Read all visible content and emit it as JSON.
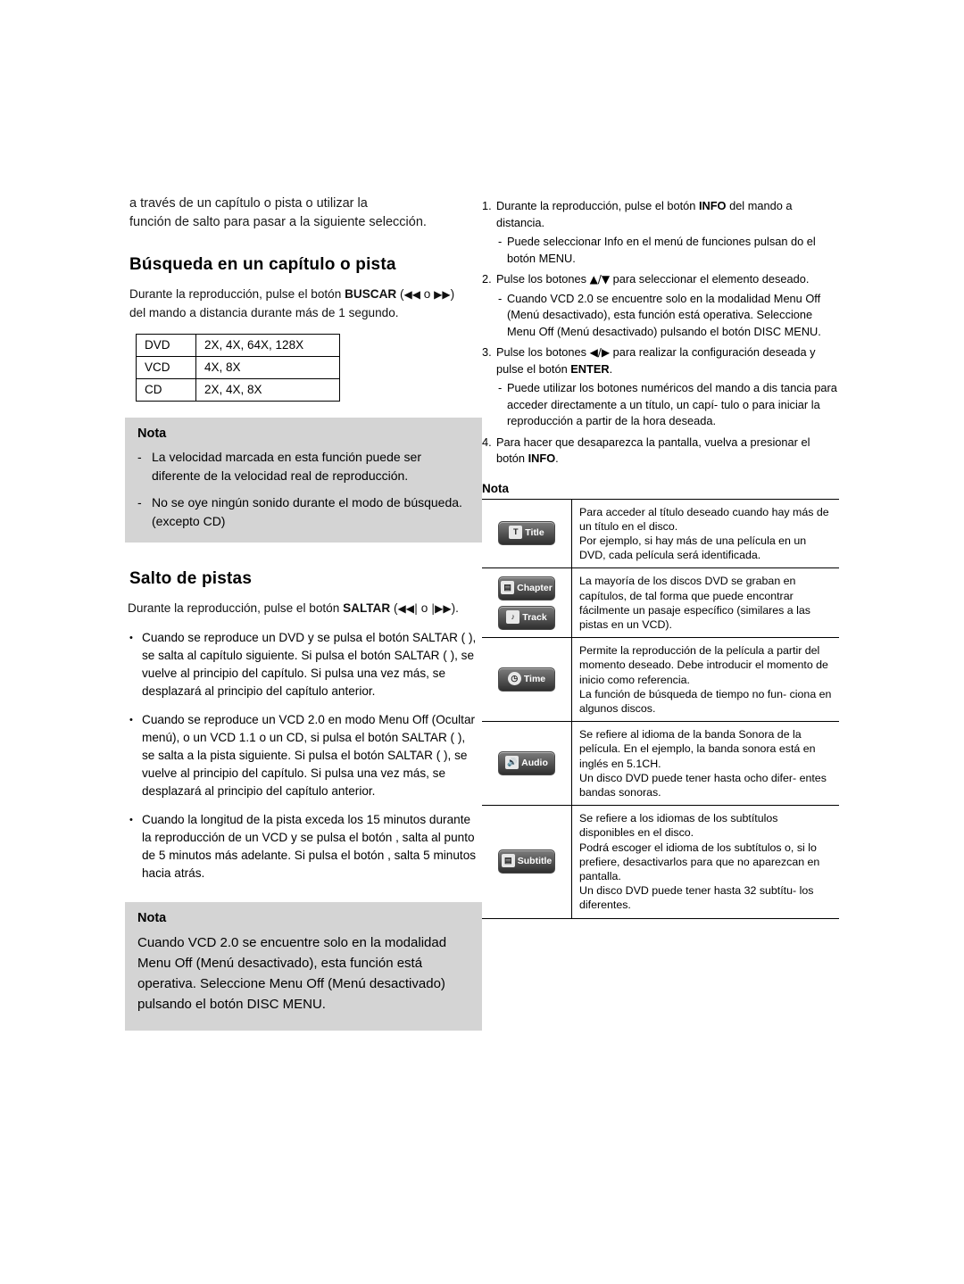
{
  "left": {
    "intro_line1": "a través de un capítulo o pista o utilizar la",
    "intro_line2": "función de salto para pasar a la siguiente selección.",
    "section1_title": "Búsqueda en un capítulo o pista",
    "section1_p1_a": "Durante la reproducción, pulse el botón ",
    "section1_p1_bold": "BUSCAR",
    "section1_p1_b": " (",
    "section1_p1_c": " o ",
    "section1_p1_d": ")",
    "section1_p2": "del mando a distancia durante más de 1 segundo.",
    "speed_table": {
      "rows": [
        {
          "format": "DVD",
          "speeds": "2X, 4X, 64X, 128X"
        },
        {
          "format": "VCD",
          "speeds": "4X, 8X"
        },
        {
          "format": "CD",
          "speeds": "2X, 4X, 8X"
        }
      ]
    },
    "nota1": {
      "title": "Nota",
      "items": [
        "La velocidad marcada en esta función puede ser diferente de la velocidad real de reproducción.",
        "No se oye ningún sonido durante el modo de búsqueda.(excepto CD)"
      ]
    },
    "section2_title": "Salto de pistas",
    "section2_p1_a": "Durante la reproducción, pulse el botón ",
    "section2_p1_bold": "SALTAR",
    "section2_p1_b": " (",
    "section2_p1_c": " o ",
    "section2_p1_d": ").",
    "bullets": [
      "Cuando se reproduce un DVD y se pulsa el botón SALTAR (    ), se salta al capítulo siguiente. Si pulsa el botón SALTAR (    ), se vuelve al principio del capítulo. Si pulsa una vez más, se desplazará al principio del capítulo anterior.",
      "Cuando se reproduce un VCD 2.0 en modo Menu Off (Ocultar menú), o un VCD 1.1 o un CD, si pulsa el botón SALTAR (    ), se salta a la pista siguiente. Si pulsa el botón SALTAR (    ), se vuelve al principio del capítulo. Si pulsa una vez más, se desplazará al principio del capítulo anterior.",
      "Cuando la longitud de la pista exceda los 15 minutos durante la reproducción de un VCD y se pulsa el botón     , salta al punto de 5 minutos más adelante. Si pulsa el botón    , salta 5 minutos hacia atrás."
    ],
    "nota2": {
      "title": "Nota",
      "text": "Cuando VCD 2.0 se encuentre solo en la modalidad Menu Off (Menú desactivado), esta función está operativa. Seleccione Menu Off (Menú desactivado) pulsando el botón DISC MENU."
    }
  },
  "right": {
    "steps": [
      {
        "index": "1.",
        "text_a": "Durante la reproducción, pulse el botón ",
        "bold": "INFO",
        "text_b": " del mando a distancia.",
        "subs": [
          "Puede seleccionar Info en el menú de funciones pulsan  do el botón MENU."
        ]
      },
      {
        "index": "2.",
        "text_a": "Pulse los botones ",
        "bold": "",
        "text_b": " para seleccionar el elemento deseado.",
        "subs": [
          "Cuando VCD 2.0 se encuentre solo en la modalidad Menu Off (Menú desactivado), esta función está operativa. Seleccione Menu Off (Menú desactivado) pulsando el botón DISC MENU."
        ]
      },
      {
        "index": "3.",
        "text_a": "Pulse los botones ",
        "bold": "ENTER",
        "text_b": " para realizar la configuración deseada y pulse el botón ",
        "subs": [
          "Puede utilizar los botones numéricos del mando a dis tancia para acceder directamente a un título, un capí- tulo o para iniciar la reproducción a partir de la hora deseada."
        ]
      },
      {
        "index": "4.",
        "text_a": "Para hacer que desaparezca la pantalla, vuelva a presionar el botón ",
        "bold": "INFO",
        "text_b": ".",
        "subs": []
      }
    ],
    "nota_title": "Nota",
    "icon_rows": [
      {
        "icon_label": "Title",
        "icon_glyph": "T",
        "icon_name": "title-icon",
        "desc": "Para acceder al título deseado cuando hay más de un título en el disco.\nPor ejemplo, si hay más de una película en un DVD, cada película será identificada."
      },
      {
        "icon_label": "Chapter",
        "icon_glyph": "",
        "icon_name": "chapter-icon",
        "second_label": "Track",
        "second_glyph": "",
        "second_name": "track-icon",
        "desc": "La mayoría de los discos DVD se graban en capítulos, de tal forma que puede encontrar fácilmente un pasaje específico (similares a las pistas en un VCD)."
      },
      {
        "icon_label": "Time",
        "icon_glyph": "",
        "icon_name": "time-icon",
        "desc": "Permite la reproducción de la película a partir del momento deseado. Debe introducir el momento de inicio como referencia.\nLa función de búsqueda de tiempo no fun- ciona en algunos discos."
      },
      {
        "icon_label": "Audio",
        "icon_glyph": "",
        "icon_name": "audio-icon",
        "desc": "Se refiere al idioma de la banda Sonora de la película. En el ejemplo, la banda sonora está en inglés en 5.1CH.\nUn disco DVD puede tener hasta ocho difer- entes bandas sonoras."
      },
      {
        "icon_label": "Subtitle",
        "icon_glyph": "",
        "icon_name": "subtitle-icon",
        "desc": "Se refiere a los idiomas de los subtítulos disponibles en el disco.\nPodrá escoger el idioma de los subtítulos o, si lo prefiere, desactivarlos para que no aparezcan en pantalla.\nUn disco DVD puede tener hasta 32 subtítu- los diferentes."
      }
    ]
  }
}
